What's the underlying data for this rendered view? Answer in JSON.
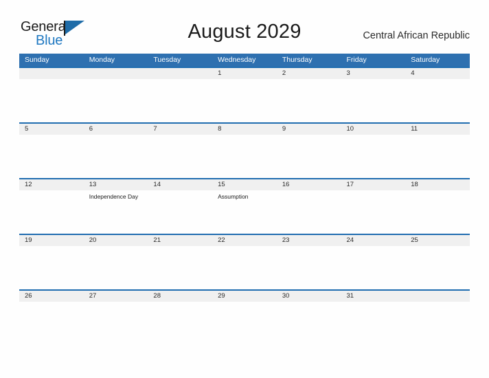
{
  "brand": {
    "name_part1": "General",
    "name_part2": "Blue",
    "flag_icon": "flag-triangle-icon"
  },
  "header": {
    "title": "August 2029",
    "country": "Central African Republic"
  },
  "colors": {
    "header_blue": "#2E70B0",
    "rule_blue": "#1F6CB0",
    "band_gray": "#F0F0F0",
    "brand_blue": "#1F78C1",
    "text_dark": "#1A1A1A"
  },
  "calendar": {
    "day_headers": [
      "Sunday",
      "Monday",
      "Tuesday",
      "Wednesday",
      "Thursday",
      "Friday",
      "Saturday"
    ],
    "weeks": [
      [
        {
          "date": "",
          "holiday": ""
        },
        {
          "date": "",
          "holiday": ""
        },
        {
          "date": "",
          "holiday": ""
        },
        {
          "date": "1",
          "holiday": ""
        },
        {
          "date": "2",
          "holiday": ""
        },
        {
          "date": "3",
          "holiday": ""
        },
        {
          "date": "4",
          "holiday": ""
        }
      ],
      [
        {
          "date": "5",
          "holiday": ""
        },
        {
          "date": "6",
          "holiday": ""
        },
        {
          "date": "7",
          "holiday": ""
        },
        {
          "date": "8",
          "holiday": ""
        },
        {
          "date": "9",
          "holiday": ""
        },
        {
          "date": "10",
          "holiday": ""
        },
        {
          "date": "11",
          "holiday": ""
        }
      ],
      [
        {
          "date": "12",
          "holiday": ""
        },
        {
          "date": "13",
          "holiday": "Independence Day"
        },
        {
          "date": "14",
          "holiday": ""
        },
        {
          "date": "15",
          "holiday": "Assumption"
        },
        {
          "date": "16",
          "holiday": ""
        },
        {
          "date": "17",
          "holiday": ""
        },
        {
          "date": "18",
          "holiday": ""
        }
      ],
      [
        {
          "date": "19",
          "holiday": ""
        },
        {
          "date": "20",
          "holiday": ""
        },
        {
          "date": "21",
          "holiday": ""
        },
        {
          "date": "22",
          "holiday": ""
        },
        {
          "date": "23",
          "holiday": ""
        },
        {
          "date": "24",
          "holiday": ""
        },
        {
          "date": "25",
          "holiday": ""
        }
      ],
      [
        {
          "date": "26",
          "holiday": ""
        },
        {
          "date": "27",
          "holiday": ""
        },
        {
          "date": "28",
          "holiday": ""
        },
        {
          "date": "29",
          "holiday": ""
        },
        {
          "date": "30",
          "holiday": ""
        },
        {
          "date": "31",
          "holiday": ""
        },
        {
          "date": "",
          "holiday": ""
        }
      ]
    ]
  }
}
